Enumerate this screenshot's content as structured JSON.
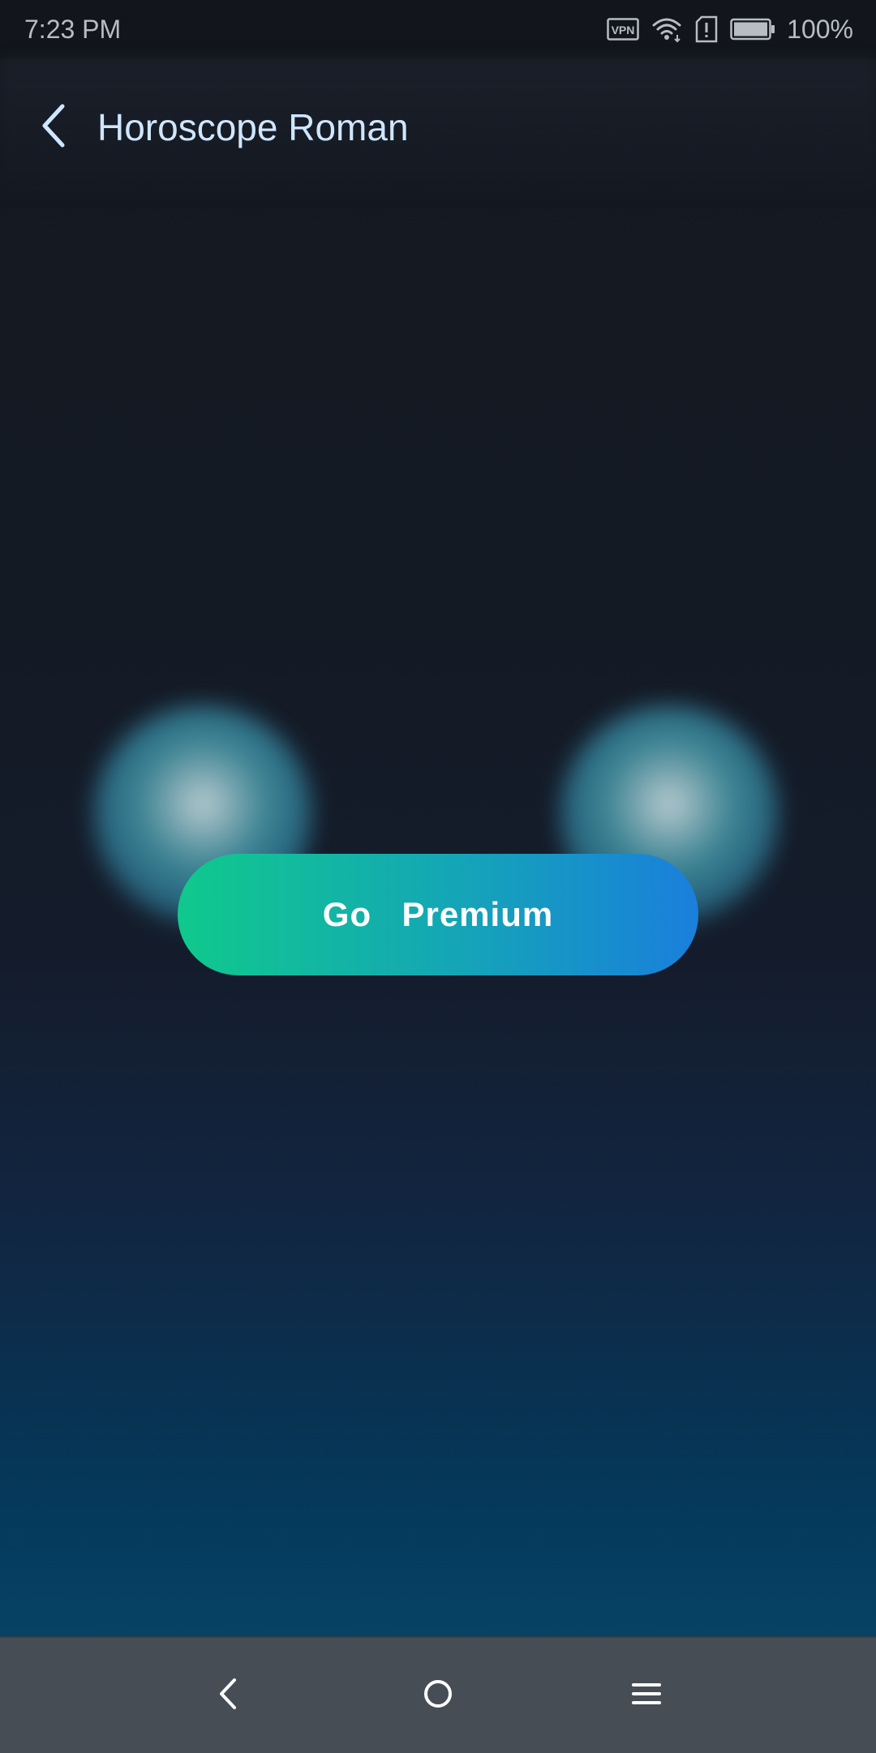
{
  "status_bar": {
    "time": "7:23 PM",
    "battery_percent": "100%",
    "icons": [
      "vpn-icon",
      "wifi-icon",
      "sim-alert-icon",
      "battery-icon"
    ]
  },
  "header": {
    "title": "Horoscope Roman",
    "back_icon": "chevron-left-icon"
  },
  "premium_button": {
    "label": "Go  Premium",
    "gradient": [
      "#10c98c",
      "#1a7fdc"
    ]
  },
  "nav_bar": {
    "buttons": [
      "back-triangle-icon",
      "home-circle-icon",
      "menu-lines-icon"
    ]
  },
  "colors": {
    "title": "#cfe6ff",
    "nav_background": "#474d54",
    "background_top": "#141820",
    "background_bottom": "#064a6e"
  }
}
